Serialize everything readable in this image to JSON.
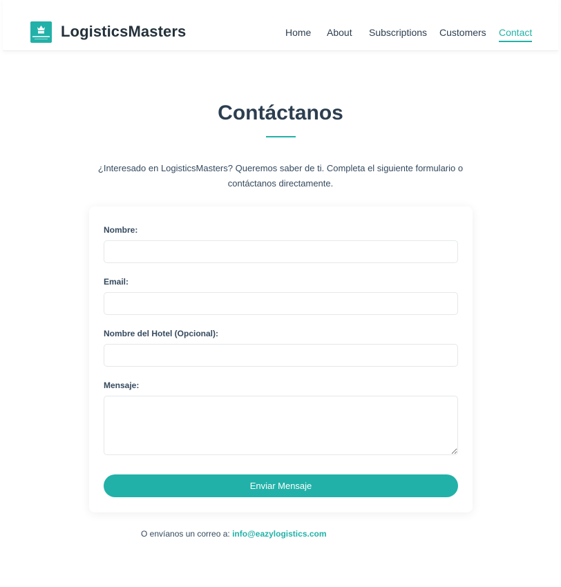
{
  "header": {
    "brand": "LogisticsMasters",
    "nav": [
      {
        "label": "Home"
      },
      {
        "label": "About"
      },
      {
        "label": "Subscriptions"
      },
      {
        "label": "Customers"
      },
      {
        "label": "Contact",
        "active": true
      }
    ]
  },
  "main": {
    "title": "Contáctanos",
    "intro": "¿Interesado en LogisticsMasters? Queremos saber de ti. Completa el siguiente formulario o contáctanos directamente."
  },
  "form": {
    "name_label": "Nombre:",
    "name_value": "",
    "email_label": "Email:",
    "email_value": "",
    "hotel_label": "Nombre del Hotel (Opcional):",
    "hotel_value": "",
    "message_label": "Mensaje:",
    "message_value": "",
    "submit_label": "Enviar Mensaje"
  },
  "footer": {
    "prefix": "O envíanos un correo a:",
    "email": "info@eazylogistics.com"
  },
  "colors": {
    "accent": "#22b1a8",
    "heading": "#2c3e50"
  }
}
